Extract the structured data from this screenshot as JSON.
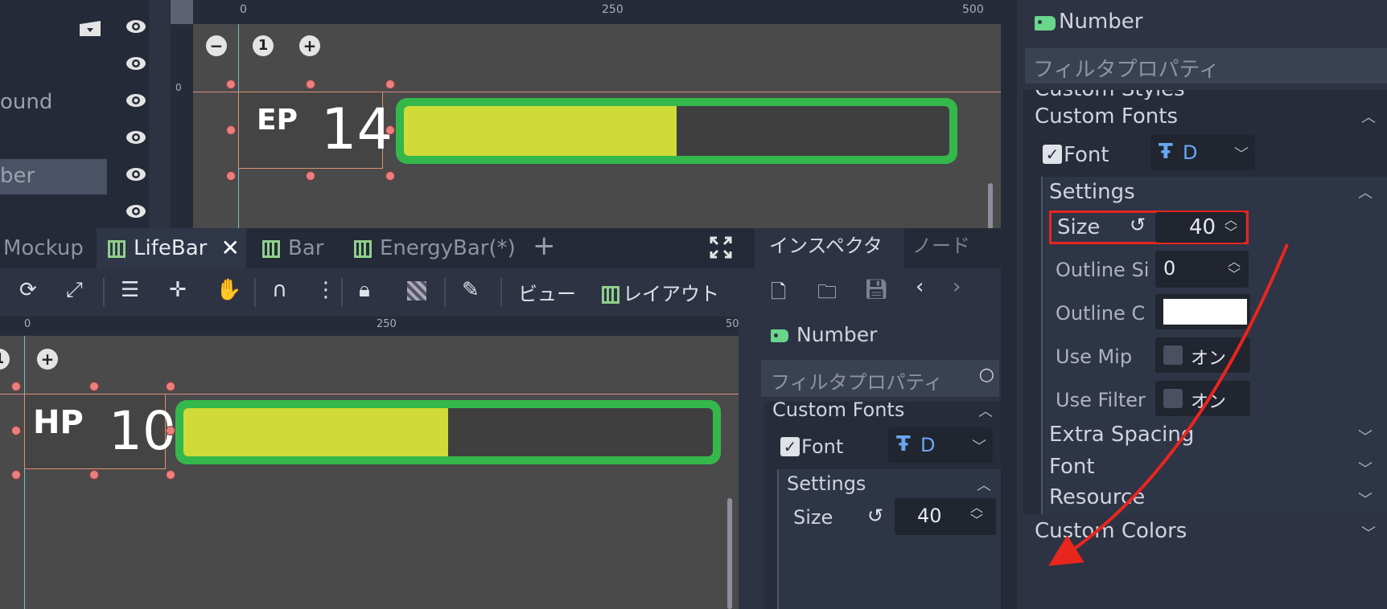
{
  "scene_tree": {
    "partial_labels": [
      "ound",
      "ber"
    ]
  },
  "top_viewport": {
    "ruler_labels": [
      "0",
      "250",
      "500"
    ],
    "ruler_side_label": "0",
    "zoom_labels": [
      "−",
      "1",
      "+"
    ],
    "ep": {
      "prefix": "EP",
      "value": "14"
    },
    "bar_fill_fraction": 0.5
  },
  "tabs": [
    {
      "label": "Mockup",
      "icon": "none"
    },
    {
      "label": "LifeBar",
      "icon": "scene-grid-icon",
      "active": true
    },
    {
      "label": "Bar",
      "icon": "scene-grid-icon"
    },
    {
      "label": "EnergyBar(*)",
      "icon": "scene-grid-icon"
    }
  ],
  "toolbar": {
    "view_label": "ビュー",
    "layout_label": "レイアウト"
  },
  "bottom_viewport": {
    "ruler_labels": [
      "0",
      "250",
      "50"
    ],
    "zoom_labels": [
      "1",
      "+"
    ],
    "hp": {
      "prefix": "HP",
      "value": "10"
    },
    "bar_fill_fraction": 0.5
  },
  "inspector_small": {
    "tab_inspector": "インスペクタ",
    "tab_node": "ノード",
    "node_name": "Number",
    "filter_placeholder": "フィルタプロパティ",
    "section_custom_fonts": "Custom Fonts",
    "font_label": "Font",
    "font_value": "D",
    "settings_label": "Settings",
    "size_label": "Size",
    "size_value": "40"
  },
  "inspector_large": {
    "node_name": "Number",
    "filter_placeholder": "フィルタプロパティ",
    "custom_styles": "Custom Styles",
    "section_custom_fonts": "Custom Fonts",
    "font_label": "Font",
    "font_value": "D",
    "settings_label": "Settings",
    "size_label": "Size",
    "size_value": "40",
    "outline_size_label": "Outline Si",
    "outline_size_value": "0",
    "outline_color_label": "Outline C",
    "use_mip_label": "Use Mip",
    "use_mip_value": "オン",
    "use_filter_label": "Use Filter",
    "use_filter_value": "オン",
    "extra_spacing": "Extra Spacing",
    "font_section": "Font",
    "resource": "Resource",
    "custom_colors": "Custom Colors"
  },
  "colors": {
    "accent_green": "#35b84b",
    "bar_fill": "#d0db3a",
    "highlight_red": "#e8261e"
  }
}
